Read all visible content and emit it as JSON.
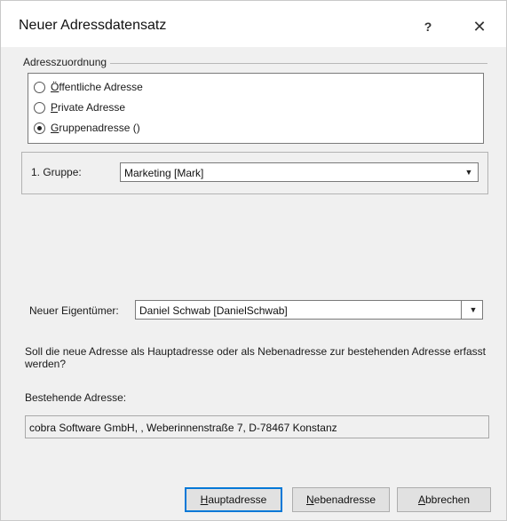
{
  "window": {
    "title": "Neuer Adressdatensatz",
    "help_label": "?",
    "close_label": "✕"
  },
  "address_assignment": {
    "group_label": "Adresszuordnung",
    "options": [
      {
        "first": "Ö",
        "rest": "ffentliche Adresse",
        "checked": false
      },
      {
        "first": "P",
        "rest": "rivate Adresse",
        "checked": false
      },
      {
        "first": "G",
        "rest": "ruppenadresse ()",
        "checked": true
      }
    ]
  },
  "group": {
    "label": "1. Gruppe:",
    "value": "Marketing [Mark]",
    "arrow": "▼"
  },
  "owner": {
    "label": "Neuer Eigentümer:",
    "value": "Daniel Schwab [DanielSchwab]",
    "arrow": "▼"
  },
  "question": "Soll die neue Adresse als Hauptadresse oder als Nebenadresse zur bestehenden Adresse erfasst werden?",
  "existing": {
    "label": "Bestehende Adresse:",
    "value": "cobra Software GmbH, , Weberinnenstraße 7, D-78467 Konstanz"
  },
  "buttons": {
    "haupt": {
      "first": "H",
      "rest": "auptadresse"
    },
    "neben": {
      "first": "N",
      "rest": "ebenadresse"
    },
    "abbrechen": {
      "first": "A",
      "rest": "bbrechen"
    }
  }
}
